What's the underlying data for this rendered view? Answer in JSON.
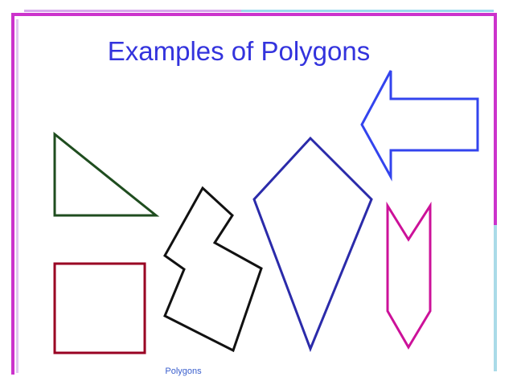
{
  "slide": {
    "title": "Examples of Polygons",
    "footer": "Polygons"
  },
  "colors": {
    "title": "#3333dd",
    "footer": "#3a5fcd",
    "border_purple": "#cc33cc",
    "border_light": "#cc99e6",
    "border_cyan": "#99ddee",
    "triangle": "#1f4d1f",
    "square": "#990022",
    "irregular": "#111111",
    "kite": "#2b2baa",
    "arrow": "#3344ee",
    "chevron": "#cc1199"
  },
  "shapes": [
    {
      "name": "triangle"
    },
    {
      "name": "square"
    },
    {
      "name": "irregular-polygon"
    },
    {
      "name": "kite"
    },
    {
      "name": "arrow"
    },
    {
      "name": "chevron"
    }
  ]
}
